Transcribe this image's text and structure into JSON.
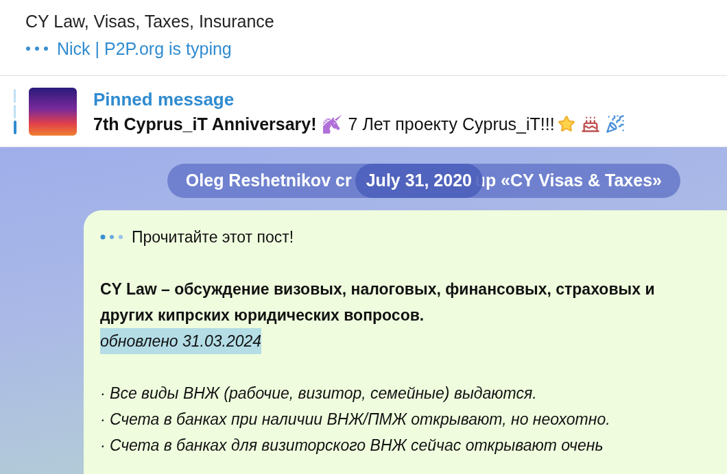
{
  "chat": {
    "title": "CY Law, Visas, Taxes, Insurance",
    "typing": "Nick | P2P.org is typing"
  },
  "pinned": {
    "label": "Pinned message",
    "parts": [
      {
        "kind": "bold",
        "text": "7th Cyprus_iT Anniversary!"
      },
      {
        "kind": "unicorn"
      },
      {
        "kind": "text",
        "text": "7 Лет проекту Cyprus_iT!!!"
      },
      {
        "kind": "star"
      },
      {
        "kind": "cake"
      },
      {
        "kind": "party"
      }
    ]
  },
  "service": {
    "text_left": "Oleg Reshetnikov cr",
    "text_right": "up «CY Visas & Taxes»",
    "date": "July 31, 2020"
  },
  "message": {
    "intro": "Прочитайте этот пост!",
    "heading": "CY Law – обсуждение визовых, налоговых, финансовых, страховых и других кипрских юридических вопросов.",
    "updated": "обновлено 31.03.2024",
    "bullets": [
      "· Все виды ВНЖ (рабочие, визитор, семейные) выдаются.",
      "· Счета в банках при наличии ВНЖ/ПМЖ открывают, но неохотно.",
      "· Счета в банках для визиторского ВНЖ сейчас открывают очень"
    ]
  }
}
